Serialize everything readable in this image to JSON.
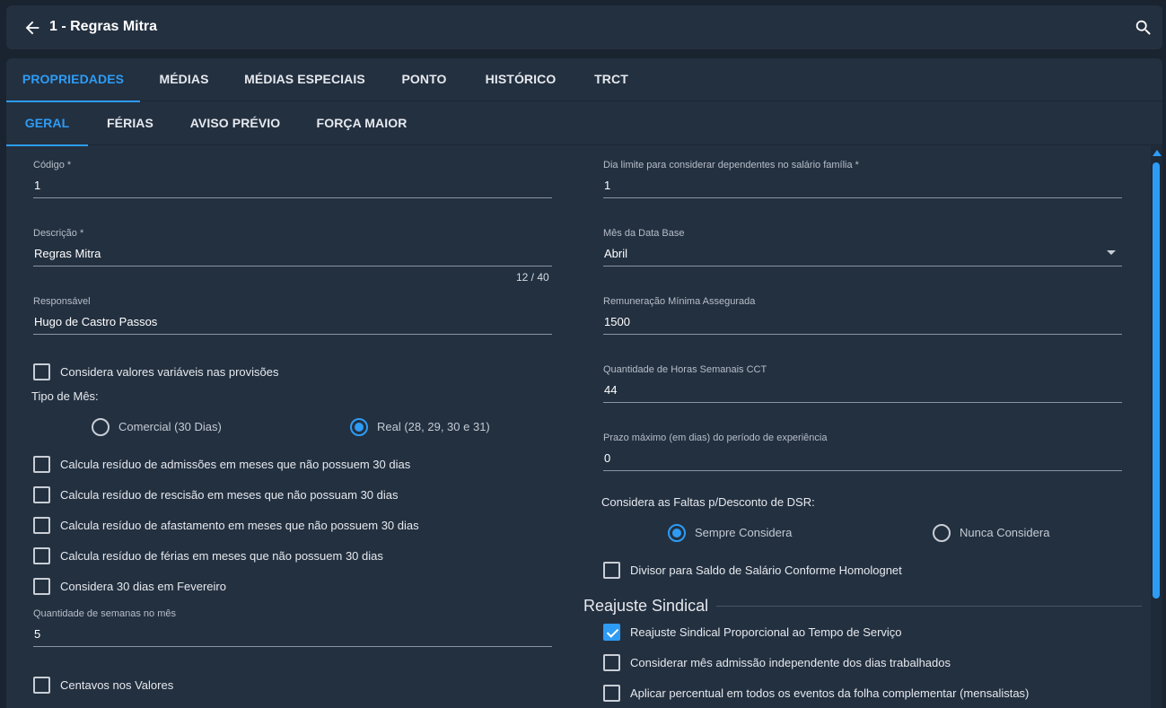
{
  "header": {
    "title": "1 - Regras Mitra"
  },
  "tabs_primary": [
    {
      "label": "PROPRIEDADES",
      "active": true
    },
    {
      "label": "MÉDIAS",
      "active": false
    },
    {
      "label": "MÉDIAS ESPECIAIS",
      "active": false
    },
    {
      "label": "PONTO",
      "active": false
    },
    {
      "label": "HISTÓRICO",
      "active": false
    },
    {
      "label": "TRCT",
      "active": false
    }
  ],
  "tabs_secondary": [
    {
      "label": "GERAL",
      "active": true
    },
    {
      "label": "FÉRIAS",
      "active": false
    },
    {
      "label": "AVISO PRÉVIO",
      "active": false
    },
    {
      "label": "FORÇA MAIOR",
      "active": false
    }
  ],
  "left": {
    "codigo": {
      "label": "Código *",
      "value": "1"
    },
    "descricao": {
      "label": "Descrição *",
      "value": "Regras Mitra",
      "counter": "12 / 40"
    },
    "responsavel": {
      "label": "Responsável",
      "value": "Hugo de Castro Passos"
    },
    "considera_variaveis": {
      "label": "Considera valores variáveis nas provisões",
      "checked": false
    },
    "tipo_mes": {
      "label": "Tipo de Mês:",
      "options": [
        {
          "label": "Comercial (30 Dias)",
          "selected": false
        },
        {
          "label": "Real (28, 29, 30 e 31)",
          "selected": true
        }
      ]
    },
    "checkboxes": [
      {
        "label": "Calcula resíduo de admissões em meses que não possuem 30 dias",
        "checked": false
      },
      {
        "label": "Calcula resíduo de rescisão em meses que não possuam 30 dias",
        "checked": false
      },
      {
        "label": "Calcula resíduo de afastamento em meses que não possuem 30 dias",
        "checked": false
      },
      {
        "label": "Calcula resíduo de férias em meses que não possuem 30 dias",
        "checked": false
      },
      {
        "label": "Considera 30 dias em Fevereiro",
        "checked": false
      }
    ],
    "semanas": {
      "label": "Quantidade de semanas no mês",
      "value": "5"
    },
    "centavos": {
      "label": "Centavos nos Valores",
      "checked": false
    }
  },
  "right": {
    "dia_limite": {
      "label": "Dia limite para considerar dependentes no salário família *",
      "value": "1"
    },
    "mes_data_base": {
      "label": "Mês da Data Base",
      "value": "Abril"
    },
    "remuneracao": {
      "label": "Remuneração Mínima Assegurada",
      "value": "1500"
    },
    "horas_semanais": {
      "label": "Quantidade de Horas Semanais CCT",
      "value": "44"
    },
    "prazo": {
      "label": "Prazo máximo (em dias) do período de experiência",
      "value": "0"
    },
    "faltas_dsr": {
      "label": "Considera as Faltas p/Desconto de DSR:",
      "options": [
        {
          "label": "Sempre Considera",
          "selected": true
        },
        {
          "label": "Nunca Considera",
          "selected": false
        }
      ]
    },
    "divisor": {
      "label": "Divisor para Saldo de Salário Conforme Homolognet",
      "checked": false
    },
    "reajuste": {
      "title": "Reajuste Sindical",
      "items": [
        {
          "label": "Reajuste Sindical Proporcional ao Tempo de Serviço",
          "checked": true
        },
        {
          "label": "Considerar mês admissão independente dos dias trabalhados",
          "checked": false
        },
        {
          "label": "Aplicar percentual em todos os eventos da folha complementar (mensalistas)",
          "checked": false
        }
      ]
    }
  },
  "colors": {
    "accent": "#2e9cf5",
    "background": "#1a2330",
    "panel": "#233040"
  },
  "icons": {
    "back": "arrow-left-icon",
    "search": "search-icon"
  }
}
